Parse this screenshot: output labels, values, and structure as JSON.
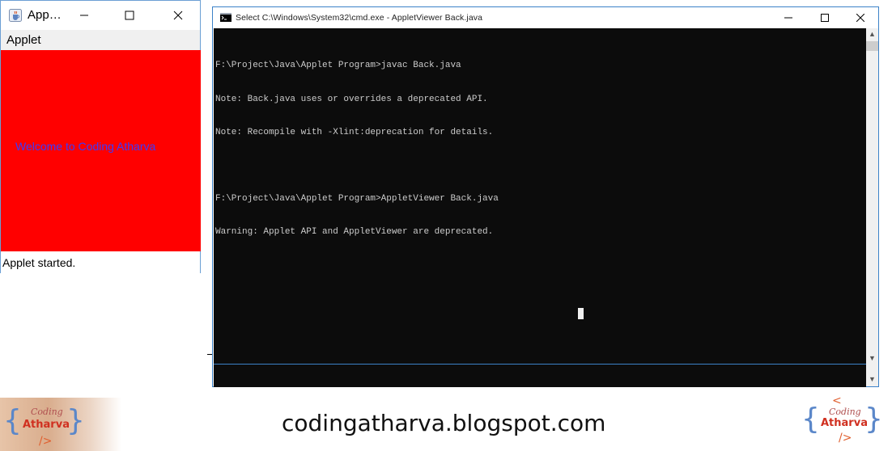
{
  "applet_window": {
    "title": "App…",
    "menu": [
      "Applet"
    ],
    "welcome_text": "Welcome to Coding Atharva",
    "status": "Applet started."
  },
  "cmd_window": {
    "title": "Select C:\\Windows\\System32\\cmd.exe - AppletViewer  Back.java",
    "lines": [
      "F:\\Project\\Java\\Applet Program>javac Back.java",
      "Note: Back.java uses or overrides a deprecated API.",
      "Note: Recompile with -Xlint:deprecation for details.",
      "",
      "F:\\Project\\Java\\Applet Program>AppletViewer Back.java",
      "Warning: Applet API and AppletViewer are deprecated."
    ]
  },
  "branding": {
    "site": "codingatharva.blogspot.com",
    "logo_top": "Coding",
    "logo_main": "Atharva"
  },
  "colors": {
    "applet_background": "#ff0000",
    "welcome_text": "#3a3aff",
    "console_background": "#0c0c0c",
    "console_text": "#cccccc",
    "window_border": "#3c82c8"
  },
  "icons": [
    "java-cup-icon",
    "minimize-icon",
    "maximize-icon",
    "close-icon",
    "cmd-icon",
    "scroll-up-icon",
    "scroll-down-icon"
  ]
}
